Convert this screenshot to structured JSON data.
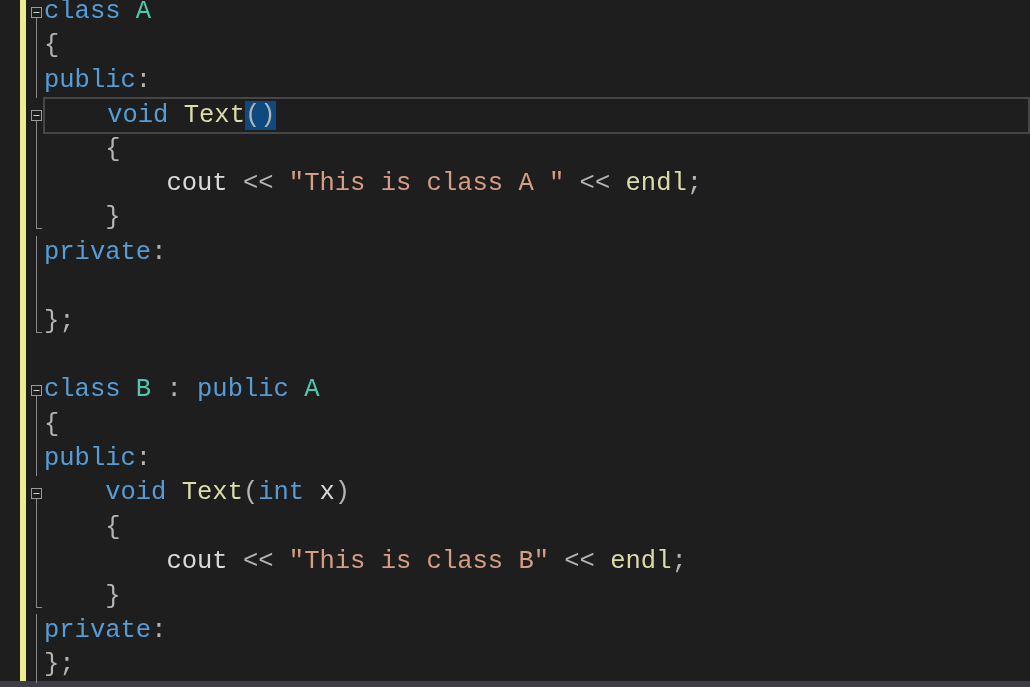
{
  "lines": [
    {
      "kind": "fold-start",
      "current": false,
      "tokens": [
        {
          "kind": "keyword",
          "text": "class"
        },
        {
          "kind": "type",
          "text": " A"
        }
      ]
    },
    {
      "kind": "fold-inside",
      "current": false,
      "tokens": [
        {
          "kind": "punct",
          "text": "{"
        }
      ]
    },
    {
      "kind": "fold-inside",
      "current": false,
      "tokens": [
        {
          "kind": "keyword",
          "text": "public"
        },
        {
          "kind": "punct",
          "text": ":"
        }
      ]
    },
    {
      "kind": "fold-start",
      "current": true,
      "tokens": [
        {
          "kind": "keyword",
          "text": "    void"
        },
        {
          "kind": "func",
          "text": " Text"
        },
        {
          "kind": "punct",
          "text": "()",
          "highlighted": true
        }
      ]
    },
    {
      "kind": "fold-inside",
      "current": false,
      "tokens": [
        {
          "kind": "punct",
          "text": "    {"
        }
      ]
    },
    {
      "kind": "fold-inside",
      "current": false,
      "tokens": [
        {
          "kind": "plain",
          "text": "        cout"
        },
        {
          "kind": "punct",
          "text": " <<"
        },
        {
          "kind": "string",
          "text": " \"This is class A \""
        },
        {
          "kind": "punct",
          "text": " <<"
        },
        {
          "kind": "func",
          "text": " endl"
        },
        {
          "kind": "punct",
          "text": ";"
        }
      ]
    },
    {
      "kind": "fold-end",
      "current": false,
      "tokens": [
        {
          "kind": "punct",
          "text": "    }"
        }
      ]
    },
    {
      "kind": "fold-inside",
      "current": false,
      "tokens": [
        {
          "kind": "keyword",
          "text": "private"
        },
        {
          "kind": "punct",
          "text": ":"
        }
      ]
    },
    {
      "kind": "fold-inside",
      "current": false
    },
    {
      "kind": "fold-end",
      "current": false,
      "tokens": [
        {
          "kind": "punct",
          "text": "};"
        }
      ]
    },
    {
      "kind": "plain",
      "current": false
    },
    {
      "kind": "fold-start",
      "current": false,
      "tokens": [
        {
          "kind": "keyword",
          "text": "class"
        },
        {
          "kind": "type",
          "text": " B"
        },
        {
          "kind": "punct",
          "text": " :"
        },
        {
          "kind": "keyword",
          "text": " public"
        },
        {
          "kind": "type",
          "text": " A"
        }
      ]
    },
    {
      "kind": "fold-inside",
      "current": false,
      "tokens": [
        {
          "kind": "punct",
          "text": "{"
        }
      ]
    },
    {
      "kind": "fold-inside",
      "current": false,
      "tokens": [
        {
          "kind": "keyword",
          "text": "public"
        },
        {
          "kind": "punct",
          "text": ":"
        }
      ]
    },
    {
      "kind": "fold-start",
      "current": false,
      "tokens": [
        {
          "kind": "keyword",
          "text": "    void"
        },
        {
          "kind": "func",
          "text": " Text"
        },
        {
          "kind": "punct",
          "text": "("
        },
        {
          "kind": "keyword",
          "text": "int"
        },
        {
          "kind": "plain",
          "text": " x"
        },
        {
          "kind": "punct",
          "text": ")"
        }
      ]
    },
    {
      "kind": "fold-inside",
      "current": false,
      "tokens": [
        {
          "kind": "punct",
          "text": "    {"
        }
      ]
    },
    {
      "kind": "fold-inside",
      "current": false,
      "tokens": [
        {
          "kind": "plain",
          "text": "        cout"
        },
        {
          "kind": "punct",
          "text": " <<"
        },
        {
          "kind": "string",
          "text": " \"This is class B\""
        },
        {
          "kind": "punct",
          "text": " <<"
        },
        {
          "kind": "func",
          "text": " endl"
        },
        {
          "kind": "punct",
          "text": ";"
        }
      ]
    },
    {
      "kind": "fold-end",
      "current": false,
      "tokens": [
        {
          "kind": "punct",
          "text": "    }"
        }
      ]
    },
    {
      "kind": "fold-inside",
      "current": false,
      "tokens": [
        {
          "kind": "keyword",
          "text": "private"
        },
        {
          "kind": "punct",
          "text": ":"
        }
      ]
    },
    {
      "kind": "fold-inside",
      "current": false,
      "tokens": [
        {
          "kind": "punct",
          "text": "};"
        }
      ]
    }
  ]
}
